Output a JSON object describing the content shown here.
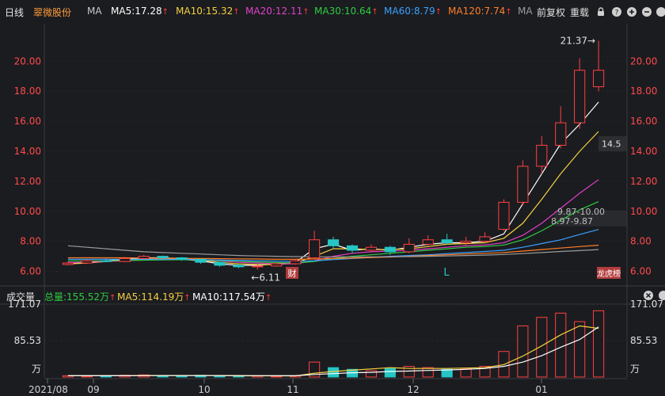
{
  "header": {
    "period": "日线",
    "stock_name": "翠微股份",
    "ma_label": "MA",
    "ma_items": [
      {
        "text": "MA5:17.28",
        "color": "#ffffff"
      },
      {
        "text": "MA10:15.32",
        "color": "#f4d03f"
      },
      {
        "text": "MA20:12.11",
        "color": "#e040c8"
      },
      {
        "text": "MA30:10.64",
        "color": "#2ecc40"
      },
      {
        "text": "MA60:8.79",
        "color": "#3aa0ff"
      },
      {
        "text": "MA120:7.74",
        "color": "#ff7f27"
      }
    ],
    "ma_overflow": "MA",
    "adjust_label": "前复权",
    "overlay_label": "重载",
    "up_arrow": "↑"
  },
  "volume_header": {
    "title": "成交量",
    "total": "总量:155.52万",
    "ma5": "MA5:114.19万",
    "ma10": "MA10:117.54万"
  },
  "chart_data": [
    {
      "type": "candlestick",
      "title": "翠微股份",
      "y_ticks": [
        "20.00",
        "18.00",
        "16.00",
        "14.00",
        "12.00",
        "10.00",
        "8.00",
        "6.00"
      ],
      "ylim": [
        5.5,
        22.5
      ],
      "x_labels": [
        "2021/08",
        "09",
        "10",
        "11",
        "12",
        "01"
      ],
      "annotations": {
        "high": "21.37→",
        "low": "←6.11",
        "level1": "14.5",
        "zone1": "9.87-10.00",
        "zone2": "8.97-9.87",
        "marker_cai": "财",
        "marker_bang": "龙虎榜",
        "marker_L": "L"
      },
      "series": [
        {
          "name": "MA5",
          "color": "#ffffff",
          "values": [
            6.5,
            6.6,
            6.7,
            6.8,
            6.9,
            6.9,
            6.8,
            6.7,
            6.5,
            6.4,
            6.4,
            6.5,
            6.6,
            7.5,
            7.8,
            7.4,
            7.5,
            7.4,
            7.6,
            7.8,
            7.9,
            7.9,
            8.0,
            8.5,
            10.5,
            12.5,
            14.5,
            15.8,
            17.28
          ]
        },
        {
          "name": "MA10",
          "color": "#f4d03f",
          "values": [
            6.5,
            6.55,
            6.65,
            6.75,
            6.85,
            6.9,
            6.85,
            6.75,
            6.6,
            6.5,
            6.45,
            6.45,
            6.55,
            7.0,
            7.5,
            7.5,
            7.45,
            7.45,
            7.5,
            7.65,
            7.8,
            7.85,
            7.9,
            8.2,
            9.2,
            10.8,
            12.5,
            14.0,
            15.32
          ]
        },
        {
          "name": "MA20",
          "color": "#e040c8",
          "values": [
            6.6,
            6.6,
            6.65,
            6.7,
            6.75,
            6.8,
            6.8,
            6.75,
            6.7,
            6.6,
            6.55,
            6.5,
            6.5,
            6.7,
            7.0,
            7.2,
            7.3,
            7.35,
            7.4,
            7.5,
            7.6,
            7.7,
            7.75,
            7.9,
            8.4,
            9.2,
            10.2,
            11.2,
            12.11
          ]
        },
        {
          "name": "MA30",
          "color": "#2ecc40",
          "values": [
            6.7,
            6.7,
            6.7,
            6.72,
            6.74,
            6.76,
            6.77,
            6.76,
            6.72,
            6.68,
            6.62,
            6.58,
            6.55,
            6.65,
            6.85,
            7.0,
            7.1,
            7.2,
            7.3,
            7.4,
            7.5,
            7.6,
            7.65,
            7.75,
            8.1,
            8.7,
            9.4,
            10.1,
            10.64
          ]
        },
        {
          "name": "MA60",
          "color": "#3aa0ff",
          "values": [
            6.8,
            6.8,
            6.8,
            6.8,
            6.8,
            6.8,
            6.8,
            6.78,
            6.75,
            6.72,
            6.7,
            6.68,
            6.66,
            6.7,
            6.78,
            6.85,
            6.92,
            7.0,
            7.05,
            7.1,
            7.18,
            7.25,
            7.32,
            7.4,
            7.6,
            7.85,
            8.1,
            8.45,
            8.79
          ]
        },
        {
          "name": "MA120",
          "color": "#ff7f27",
          "values": [
            6.9,
            6.9,
            6.9,
            6.9,
            6.88,
            6.87,
            6.86,
            6.85,
            6.84,
            6.83,
            6.82,
            6.8,
            6.8,
            6.82,
            6.85,
            6.88,
            6.92,
            6.95,
            7.0,
            7.05,
            7.1,
            7.15,
            7.2,
            7.25,
            7.35,
            7.45,
            7.55,
            7.65,
            7.74
          ]
        },
        {
          "name": "MA250",
          "color": "#9b9b9b",
          "values": [
            7.7,
            7.6,
            7.5,
            7.4,
            7.3,
            7.25,
            7.2,
            7.15,
            7.1,
            7.05,
            7.02,
            7.0,
            6.98,
            6.97,
            6.96,
            6.96,
            6.96,
            6.97,
            6.98,
            7.0,
            7.02,
            7.05,
            7.08,
            7.12,
            7.18,
            7.25,
            7.32,
            7.38,
            7.45
          ]
        }
      ],
      "candles": [
        [
          6.45,
          6.55,
          6.65,
          6.4
        ],
        [
          6.55,
          6.7,
          6.8,
          6.5
        ],
        [
          6.7,
          6.65,
          6.85,
          6.6
        ],
        [
          6.65,
          6.85,
          6.95,
          6.6
        ],
        [
          6.85,
          7.0,
          7.1,
          6.8
        ],
        [
          7.0,
          6.9,
          7.05,
          6.8
        ],
        [
          6.9,
          6.8,
          6.95,
          6.7
        ],
        [
          6.8,
          6.6,
          6.85,
          6.5
        ],
        [
          6.6,
          6.4,
          6.65,
          6.3
        ],
        [
          6.4,
          6.3,
          6.45,
          6.2
        ],
        [
          6.3,
          6.35,
          6.45,
          6.11
        ],
        [
          6.35,
          6.5,
          6.6,
          6.3
        ],
        [
          6.5,
          6.7,
          6.8,
          6.45
        ],
        [
          6.9,
          8.1,
          8.7,
          6.85
        ],
        [
          8.1,
          7.7,
          8.3,
          7.5
        ],
        [
          7.7,
          7.4,
          7.8,
          7.2
        ],
        [
          7.4,
          7.6,
          7.8,
          7.3
        ],
        [
          7.6,
          7.3,
          7.7,
          7.1
        ],
        [
          7.3,
          7.8,
          8.2,
          7.2
        ],
        [
          7.8,
          8.1,
          8.4,
          7.7
        ],
        [
          8.1,
          7.9,
          8.5,
          7.8
        ],
        [
          7.9,
          8.0,
          8.3,
          7.7
        ],
        [
          8.0,
          8.3,
          8.6,
          7.9
        ],
        [
          8.8,
          10.6,
          10.8,
          8.7
        ],
        [
          10.6,
          13.0,
          13.4,
          10.4
        ],
        [
          13.0,
          14.4,
          15.0,
          12.5
        ],
        [
          14.4,
          15.9,
          17.0,
          14.2
        ],
        [
          15.9,
          19.4,
          20.2,
          15.5
        ],
        [
          18.3,
          19.4,
          21.37,
          18.0
        ]
      ]
    },
    {
      "type": "bar",
      "title": "成交量",
      "y_ticks": [
        "171.07",
        "85.53"
      ],
      "unit": "万",
      "ylim": [
        0,
        171.07
      ],
      "values": [
        3,
        2,
        3,
        4,
        5,
        3,
        2,
        4,
        3,
        2,
        3,
        2,
        3,
        35,
        22,
        18,
        15,
        20,
        25,
        22,
        18,
        20,
        25,
        60,
        120,
        140,
        150,
        130,
        155.52
      ],
      "up": [
        1,
        1,
        0,
        1,
        1,
        0,
        0,
        0,
        0,
        0,
        1,
        1,
        1,
        1,
        0,
        0,
        1,
        0,
        1,
        1,
        0,
        1,
        1,
        1,
        1,
        1,
        1,
        1,
        1
      ],
      "ma5": [
        3,
        3,
        3,
        3,
        3.4,
        3.4,
        3.4,
        3.4,
        3.4,
        2.8,
        2.8,
        2.8,
        2.6,
        9,
        13,
        16,
        19,
        22,
        20,
        20,
        20,
        21,
        22,
        29,
        49,
        73,
        99,
        120,
        114.19
      ],
      "ma10": [
        3,
        3,
        3,
        3,
        3.2,
        3.3,
        3.3,
        3.3,
        3.4,
        3.3,
        3.1,
        3.1,
        3,
        6,
        8,
        10,
        11,
        13,
        14,
        15.5,
        16.5,
        18,
        20,
        25,
        35,
        50,
        70,
        88,
        117.54
      ]
    }
  ]
}
